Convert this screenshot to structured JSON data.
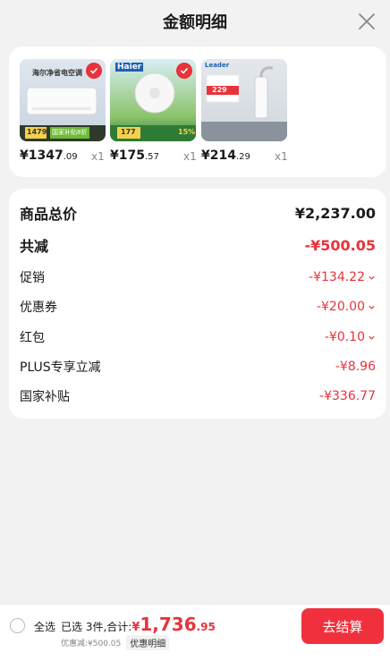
{
  "header": {
    "title": "金额明细"
  },
  "products": [
    {
      "name": "air-conditioner",
      "price_int": "¥1347",
      "price_dec": ".09",
      "qty": "x1",
      "img_text_1": "海尔净省电空调",
      "img_text_2": "1479",
      "img_text_3": "国家补贴8折"
    },
    {
      "name": "fan",
      "price_int": "¥175",
      "price_dec": ".57",
      "qty": "x1",
      "img_text_1": "Haier",
      "img_text_2": "177",
      "img_text_3": "15%"
    },
    {
      "name": "water-heater",
      "price_int": "¥214",
      "price_dec": ".29",
      "qty": "x1",
      "img_text_1": "Leader",
      "img_text_2": "229"
    }
  ],
  "summary": {
    "rows": [
      {
        "label": "商品总价",
        "value": "¥2,237.00"
      },
      {
        "label": "共减",
        "value": "-¥500.05"
      },
      {
        "label": "促销",
        "value": "-¥134.22"
      },
      {
        "label": "优惠券",
        "value": "-¥20.00"
      },
      {
        "label": "红包",
        "value": "-¥0.10"
      },
      {
        "label": "PLUS专享立减",
        "value": "-¥8.96"
      },
      {
        "label": "国家补贴",
        "value": "-¥336.77"
      }
    ]
  },
  "bottom": {
    "select_all": "全选",
    "selected_text": "已选 3件,合计:",
    "total_cur": "¥",
    "total_int": "1,736",
    "total_dec": ".95",
    "discount_text": "优惠减:¥500.05",
    "detail_label": "优惠明细",
    "checkout_label": "去结算"
  },
  "colors": {
    "accent": "#e8333a",
    "button": "#f0313d"
  }
}
